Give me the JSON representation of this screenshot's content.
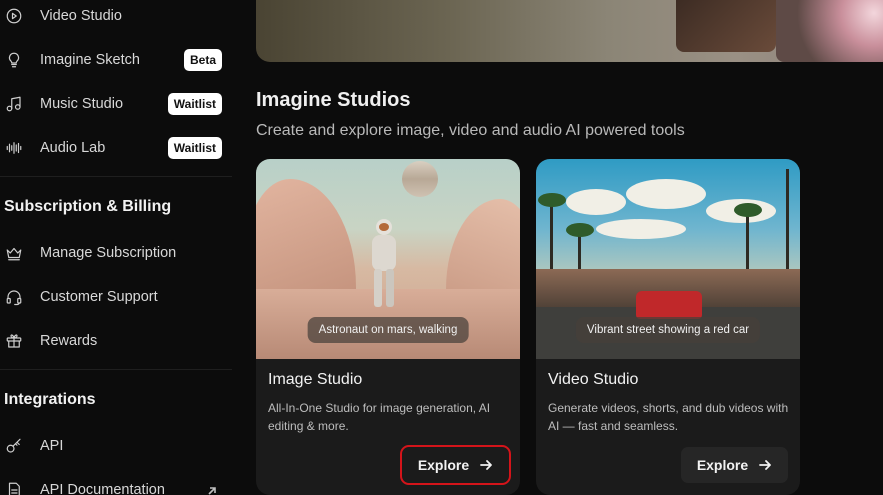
{
  "sidebar": {
    "items_top": [
      {
        "label": "Video Studio",
        "icon": "play-circle-icon"
      },
      {
        "label": "Imagine Sketch",
        "icon": "lightbulb-icon",
        "badge": "Beta"
      },
      {
        "label": "Music Studio",
        "icon": "music-note-icon",
        "badge": "Waitlist"
      },
      {
        "label": "Audio Lab",
        "icon": "waveform-icon",
        "badge": "Waitlist"
      }
    ],
    "billing": {
      "title": "Subscription & Billing",
      "items": [
        {
          "label": "Manage Subscription",
          "icon": "crown-icon"
        },
        {
          "label": "Customer Support",
          "icon": "headset-icon"
        },
        {
          "label": "Rewards",
          "icon": "gift-icon"
        }
      ]
    },
    "integrations": {
      "title": "Integrations",
      "items": [
        {
          "label": "API",
          "icon": "key-icon"
        },
        {
          "label": "API Documentation",
          "icon": "document-icon"
        }
      ]
    }
  },
  "main": {
    "title": "Imagine Studios",
    "subtitle": "Create and explore image, video and audio AI powered tools",
    "cards": [
      {
        "title": "Image Studio",
        "description": "All-In-One Studio for image generation, AI editing & more.",
        "caption": "Astronaut on mars, walking",
        "button": "Explore"
      },
      {
        "title": "Video Studio",
        "description": "Generate videos, shorts, and dub videos with AI — fast and seamless.",
        "caption": "Vibrant street showing a red car",
        "button": "Explore"
      }
    ]
  },
  "colors": {
    "background": "#0c0c0c",
    "card": "#1b1b1b",
    "badge": "#ffffff",
    "highlight": "#d4141a"
  }
}
